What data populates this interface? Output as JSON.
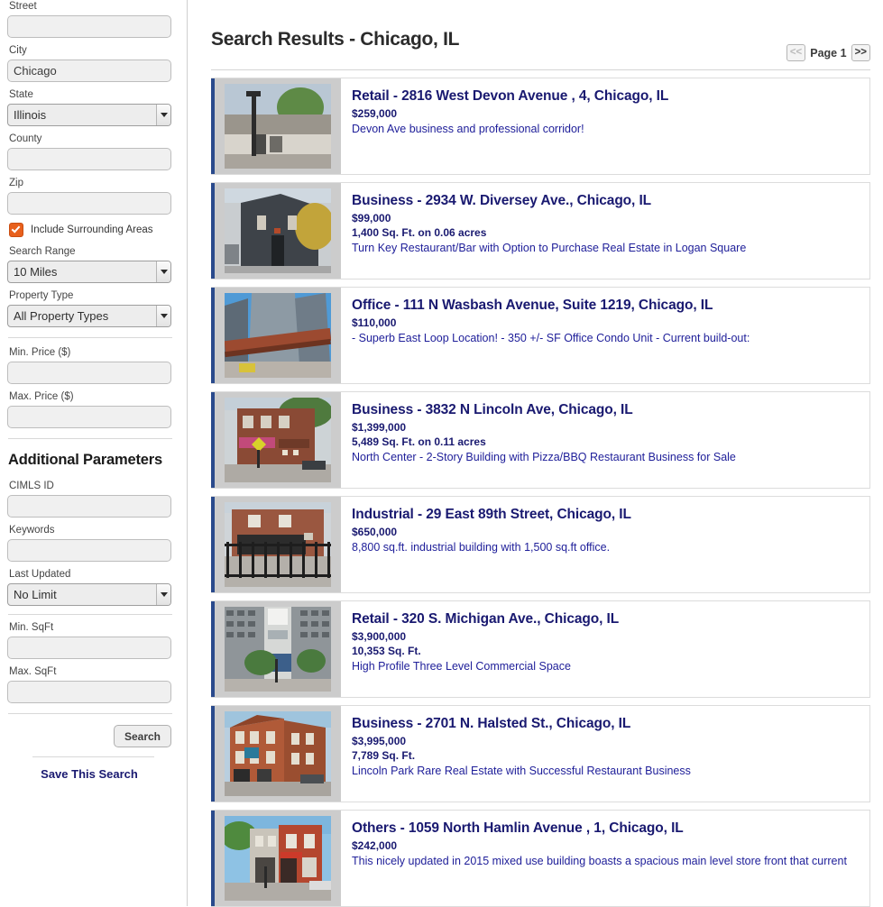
{
  "sidebar": {
    "fields": [
      {
        "label": "Street",
        "type": "text",
        "value": "",
        "placeholder": ""
      },
      {
        "label": "City",
        "type": "text",
        "value": "Chicago",
        "placeholder": ""
      },
      {
        "label": "State",
        "type": "select",
        "value": "Illinois"
      },
      {
        "label": "County",
        "type": "text",
        "value": "",
        "placeholder": ""
      },
      {
        "label": "Zip",
        "type": "text",
        "value": "",
        "placeholder": ""
      }
    ],
    "include_surrounding": {
      "label": "Include Surrounding Areas",
      "checked": true,
      "color": "#e8601c",
      "icon": "checkbox-checked-icon"
    },
    "fields2": [
      {
        "label": "Search Range",
        "type": "select",
        "value": "10 Miles"
      },
      {
        "label": "Property Type",
        "type": "select",
        "value": "All Property Types"
      }
    ],
    "fields3": [
      {
        "label": "Min. Price ($)",
        "type": "text",
        "value": "",
        "placeholder": ""
      },
      {
        "label": "Max. Price ($)",
        "type": "text",
        "value": "",
        "placeholder": ""
      }
    ],
    "additional_title": "Additional Parameters",
    "fields4": [
      {
        "label": "CIMLS ID",
        "type": "text",
        "value": "",
        "placeholder": ""
      },
      {
        "label": "Keywords",
        "type": "text",
        "value": "",
        "placeholder": ""
      },
      {
        "label": "Last Updated",
        "type": "select",
        "value": "No Limit"
      }
    ],
    "fields5": [
      {
        "label": "Min. SqFt",
        "type": "text",
        "value": "",
        "placeholder": ""
      },
      {
        "label": "Max. SqFt",
        "type": "text",
        "value": "",
        "placeholder": ""
      }
    ],
    "search_button": "Search",
    "save_search_link": "Save This Search"
  },
  "header": {
    "title": "Search Results - Chicago, IL",
    "pager": {
      "prev": "<<",
      "prev_enabled": false,
      "page_label": "Page 1",
      "next": ">>",
      "next_enabled": true
    }
  },
  "listings": [
    {
      "title": "Retail - 2816 West Devon Avenue , 4, Chicago, IL",
      "price": "$259,000",
      "size": "",
      "desc": "Devon Ave business and professional corridor!",
      "thumb": "storefront-awning-photo"
    },
    {
      "title": "Business - 2934 W. Diversey Ave., Chicago, IL",
      "price": "$99,000",
      "size": "1,400 Sq. Ft. on 0.06 acres",
      "desc": "Turn Key Restaurant/Bar with Option to Purchase Real Estate in Logan Square",
      "thumb": "dark-corner-building-photo"
    },
    {
      "title": "Office - 111 N Wasbash Avenue, Suite 1219, Chicago, IL",
      "price": "$110,000",
      "size": "",
      "desc": "- Superb East Loop Location! - 350 +/- SF Office Condo Unit - Current build-out:",
      "thumb": "highrise-el-train-photo"
    },
    {
      "title": "Business - 3832 N Lincoln Ave, Chicago, IL",
      "price": "$1,399,000",
      "size": "5,489 Sq. Ft. on 0.11 acres",
      "desc": "North Center - 2-Story Building with Pizza/BBQ Restaurant Business for Sale",
      "thumb": "brick-corner-restaurant-photo"
    },
    {
      "title": "Industrial - 29 East 89th Street, Chicago, IL",
      "price": "$650,000",
      "size": "",
      "desc": "8,800 sq.ft. industrial building with 1,500 sq.ft office.",
      "thumb": "brick-warehouse-fence-photo"
    },
    {
      "title": "Retail - 320 S. Michigan Ave., Chicago, IL",
      "price": "$3,900,000",
      "size": "10,353 Sq. Ft.",
      "desc": "High Profile Three Level Commercial Space",
      "thumb": "tall-office-facade-photo"
    },
    {
      "title": "Business - 2701 N. Halsted St., Chicago, IL",
      "price": "$3,995,000",
      "size": "7,789 Sq. Ft.",
      "desc": "Lincoln Park Rare Real Estate with Successful Restaurant Business",
      "thumb": "red-brick-greystone-photo"
    },
    {
      "title": "Others - 1059 North Hamlin Avenue , 1, Chicago, IL",
      "price": "$242,000",
      "size": "",
      "desc": "This nicely updated in 2015 mixed use building boasts a spacious main level store front that current",
      "thumb": "red-mixed-use-building-photo"
    }
  ]
}
